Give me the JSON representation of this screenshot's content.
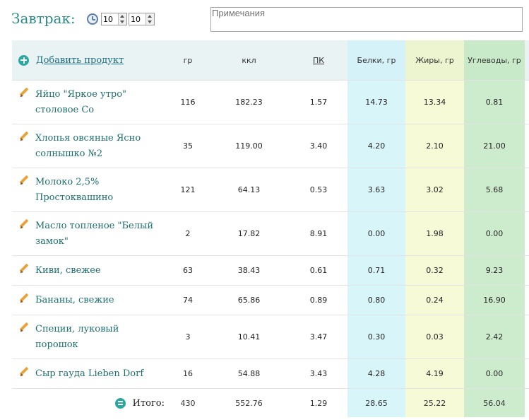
{
  "meal": {
    "title": "Завтрак:",
    "time_hours": "10",
    "time_minutes": "10",
    "notes_placeholder": "Примечания"
  },
  "table": {
    "add_label": "Добавить продукт",
    "headers": {
      "gr": "гр",
      "kcal": "ккл",
      "pk": "ПК",
      "protein": "Белки, гр",
      "fat": "Жиры, гр",
      "carbs": "Углеводы, гр"
    },
    "rows": [
      {
        "name": "Яйцо \"Яркое утро\" столовое Со",
        "gr": "116",
        "kcal": "182.23",
        "pk": "1.57",
        "protein": "14.73",
        "fat": "13.34",
        "carbs": "0.81"
      },
      {
        "name": "Хлопья овсяные Ясно солнышко №2",
        "gr": "35",
        "kcal": "119.00",
        "pk": "3.40",
        "protein": "4.20",
        "fat": "2.10",
        "carbs": "21.00"
      },
      {
        "name": "Молоко 2,5% Простоквашино",
        "gr": "121",
        "kcal": "64.13",
        "pk": "0.53",
        "protein": "3.63",
        "fat": "3.02",
        "carbs": "5.68"
      },
      {
        "name": "Масло топленое \"Белый замок\"",
        "gr": "2",
        "kcal": "17.82",
        "pk": "8.91",
        "protein": "0.00",
        "fat": "1.98",
        "carbs": "0.00"
      },
      {
        "name": "Киви, свежее",
        "gr": "63",
        "kcal": "38.43",
        "pk": "0.61",
        "protein": "0.71",
        "fat": "0.32",
        "carbs": "9.23"
      },
      {
        "name": "Бананы, свежие",
        "gr": "74",
        "kcal": "65.86",
        "pk": "0.89",
        "protein": "0.80",
        "fat": "0.24",
        "carbs": "16.90"
      },
      {
        "name": "Специи, луковый порошок",
        "gr": "3",
        "kcal": "10.41",
        "pk": "3.47",
        "protein": "0.30",
        "fat": "0.03",
        "carbs": "2.42"
      },
      {
        "name": "Сыр гауда Lieben Dorf",
        "gr": "16",
        "kcal": "54.88",
        "pk": "3.43",
        "protein": "4.28",
        "fat": "4.19",
        "carbs": "0.00"
      }
    ],
    "total": {
      "label": "Итого:",
      "gr": "430",
      "kcal": "552.76",
      "pk": "1.29",
      "protein": "28.65",
      "fat": "25.22",
      "carbs": "56.04"
    }
  },
  "colors": {
    "accent": "#2b8a8a",
    "protein_bg": "#d8f5fa",
    "fat_bg": "#f7fad6",
    "carbs_bg": "#cdeccd"
  },
  "icons": {
    "time": "clock-icon",
    "add": "plus-circle-icon",
    "edit": "pencil-icon",
    "total": "equals-icon"
  }
}
